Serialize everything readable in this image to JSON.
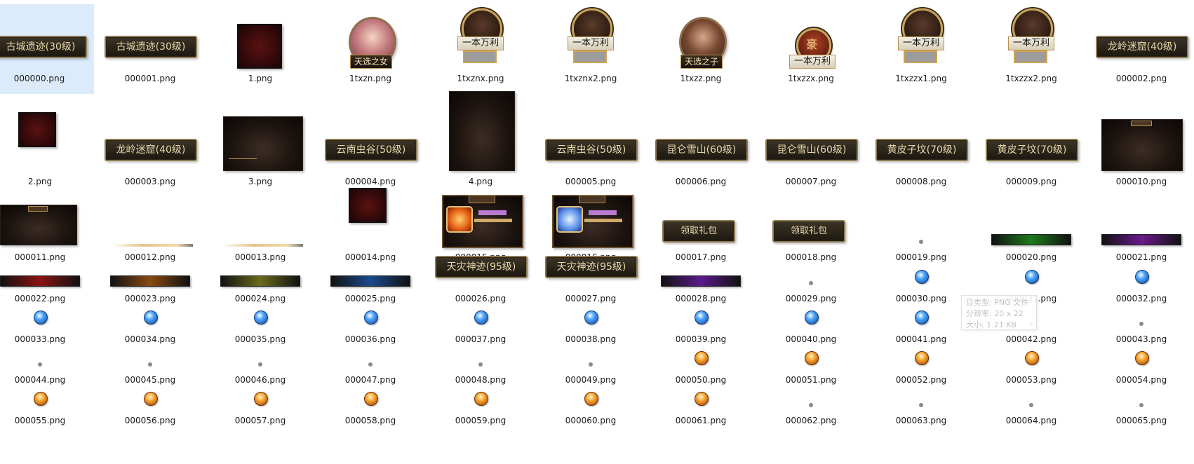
{
  "files": [
    {
      "name": "000000.png",
      "kind": "banner",
      "text": "古城遗迹(30级)",
      "selected": true
    },
    {
      "name": "000001.png",
      "kind": "banner",
      "text": "古城遗迹(30级)"
    },
    {
      "name": "1.png",
      "kind": "dark-square"
    },
    {
      "name": "1txzn.png",
      "kind": "portrait",
      "text": "天选之女",
      "tone": "female"
    },
    {
      "name": "1txznx.png",
      "kind": "badge",
      "text": "一本万利",
      "grey": true
    },
    {
      "name": "1txznx2.png",
      "kind": "badge",
      "text": "一本万利",
      "grey": true
    },
    {
      "name": "1txzz.png",
      "kind": "portrait",
      "text": "天选之子",
      "tone": "male"
    },
    {
      "name": "1txzzx.png",
      "kind": "badge-small",
      "text": "一本万利",
      "emblem": "豪"
    },
    {
      "name": "1txzzx1.png",
      "kind": "badge",
      "text": "一本万利",
      "grey": true
    },
    {
      "name": "1txzzx2.png",
      "kind": "badge",
      "text": "一本万利",
      "grey": true
    },
    {
      "name": "000002.png",
      "kind": "banner",
      "text": "龙岭迷窟(40级)"
    },
    {
      "name": "2.png",
      "kind": "dark-square-small"
    },
    {
      "name": "000003.png",
      "kind": "banner",
      "text": "龙岭迷窟(40级)"
    },
    {
      "name": "3.png",
      "kind": "dark-panel-wide"
    },
    {
      "name": "000004.png",
      "kind": "banner",
      "text": "云南虫谷(50级)"
    },
    {
      "name": "4.png",
      "kind": "dark-panel-tall"
    },
    {
      "name": "000005.png",
      "kind": "banner",
      "text": "云南虫谷(50级)"
    },
    {
      "name": "000006.png",
      "kind": "banner",
      "text": "昆仑雪山(60级)"
    },
    {
      "name": "000007.png",
      "kind": "banner",
      "text": "昆仑雪山(60级)"
    },
    {
      "name": "000008.png",
      "kind": "banner",
      "text": "黄皮子坟(70级)"
    },
    {
      "name": "000009.png",
      "kind": "banner",
      "text": "黄皮子坟(70级)"
    },
    {
      "name": "000010.png",
      "kind": "dark-panel"
    },
    {
      "name": "000011.png",
      "kind": "dark-panel-low"
    },
    {
      "name": "000012.png",
      "kind": "thin-bar"
    },
    {
      "name": "000013.png",
      "kind": "thin-bar"
    },
    {
      "name": "000014.png",
      "kind": "dark-square-small"
    },
    {
      "name": "000015.png",
      "kind": "gift-panel",
      "tone": "orange"
    },
    {
      "name": "000016.png",
      "kind": "gift-panel",
      "tone": "blue"
    },
    {
      "name": "000017.png",
      "kind": "button",
      "text": "领取礼包"
    },
    {
      "name": "000018.png",
      "kind": "button",
      "text": "领取礼包"
    },
    {
      "name": "000019.png",
      "kind": "dot"
    },
    {
      "name": "000020.png",
      "kind": "strip",
      "color": "#1d7a1d"
    },
    {
      "name": "000021.png",
      "kind": "strip",
      "color": "#6a1a8c"
    },
    {
      "name": "000022.png",
      "kind": "strip",
      "color": "#8a1414"
    },
    {
      "name": "000023.png",
      "kind": "strip",
      "color": "#8a4a12"
    },
    {
      "name": "000024.png",
      "kind": "strip",
      "color": "#6b6a1c"
    },
    {
      "name": "000025.png",
      "kind": "strip",
      "color": "#1a4a8c"
    },
    {
      "name": "000026.png",
      "kind": "banner",
      "text": "天灾神迹(95级)"
    },
    {
      "name": "000027.png",
      "kind": "banner",
      "text": "天灾神迹(95级)"
    },
    {
      "name": "000028.png",
      "kind": "strip",
      "color": "#5a1a8c"
    },
    {
      "name": "000029.png",
      "kind": "dot"
    },
    {
      "name": "000030.png",
      "kind": "orb-blue"
    },
    {
      "name": "000031.png",
      "kind": "orb-blue"
    },
    {
      "name": "000032.png",
      "kind": "orb-blue"
    },
    {
      "name": "000033.png",
      "kind": "orb-blue"
    },
    {
      "name": "000034.png",
      "kind": "orb-blue"
    },
    {
      "name": "000035.png",
      "kind": "orb-blue"
    },
    {
      "name": "000036.png",
      "kind": "orb-blue"
    },
    {
      "name": "000037.png",
      "kind": "orb-blue"
    },
    {
      "name": "000038.png",
      "kind": "orb-blue"
    },
    {
      "name": "000039.png",
      "kind": "orb-blue"
    },
    {
      "name": "000040.png",
      "kind": "orb-blue"
    },
    {
      "name": "000041.png",
      "kind": "orb-blue"
    },
    {
      "name": "000042.png",
      "kind": "dot"
    },
    {
      "name": "000043.png",
      "kind": "dot"
    },
    {
      "name": "000044.png",
      "kind": "dot"
    },
    {
      "name": "000045.png",
      "kind": "dot"
    },
    {
      "name": "000046.png",
      "kind": "dot"
    },
    {
      "name": "000047.png",
      "kind": "dot"
    },
    {
      "name": "000048.png",
      "kind": "dot"
    },
    {
      "name": "000049.png",
      "kind": "dot"
    },
    {
      "name": "000050.png",
      "kind": "orb-gold"
    },
    {
      "name": "000051.png",
      "kind": "orb-gold"
    },
    {
      "name": "000052.png",
      "kind": "orb-gold"
    },
    {
      "name": "000053.png",
      "kind": "orb-gold"
    },
    {
      "name": "000054.png",
      "kind": "orb-gold"
    },
    {
      "name": "000055.png",
      "kind": "orb-gold"
    },
    {
      "name": "000056.png",
      "kind": "orb-gold"
    },
    {
      "name": "000057.png",
      "kind": "orb-gold"
    },
    {
      "name": "000058.png",
      "kind": "orb-gold"
    },
    {
      "name": "000059.png",
      "kind": "orb-gold"
    },
    {
      "name": "000060.png",
      "kind": "orb-gold"
    },
    {
      "name": "000061.png",
      "kind": "orb-gold"
    },
    {
      "name": "000062.png",
      "kind": "dot"
    },
    {
      "name": "000063.png",
      "kind": "dot"
    },
    {
      "name": "000064.png",
      "kind": "dot"
    },
    {
      "name": "000065.png",
      "kind": "dot"
    }
  ],
  "tooltip": {
    "type_line": "目类型: PNG 文件",
    "resolution_line": "分辨率: 20 x 22",
    "size_line": "大小: 1.21 KB"
  }
}
